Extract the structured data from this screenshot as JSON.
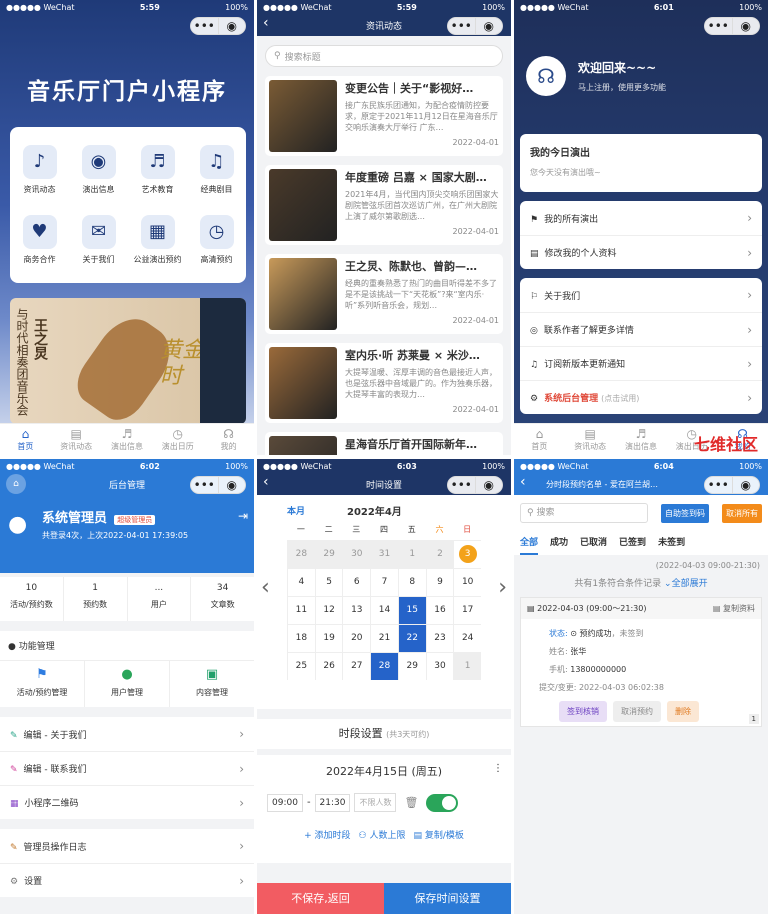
{
  "status": {
    "carrier": "●●●●● WeChat",
    "wifi": "⌔",
    "battery": "100%"
  },
  "p1": {
    "time": "5:59",
    "title": "音乐厅门户小程序",
    "grid": [
      {
        "label": "资讯动态",
        "icon": "♪"
      },
      {
        "label": "演出信息",
        "icon": "◉"
      },
      {
        "label": "艺术教育",
        "icon": "♬"
      },
      {
        "label": "经典剧目",
        "icon": "♫"
      },
      {
        "label": "商务合作",
        "icon": "♥"
      },
      {
        "label": "关于我们",
        "icon": "✉"
      },
      {
        "label": "公益演出预约",
        "icon": "▦"
      },
      {
        "label": "高清预约",
        "icon": "◷"
      }
    ],
    "poster_text": "与时代相奏团音乐会",
    "poster_name": "王之炅",
    "poster_gold": "黄金时",
    "tabs": [
      {
        "label": "首页",
        "icon": "⌂"
      },
      {
        "label": "资讯动态",
        "icon": "▤"
      },
      {
        "label": "演出信息",
        "icon": "♬"
      },
      {
        "label": "演出日历",
        "icon": "◷"
      },
      {
        "label": "我的",
        "icon": "☊"
      }
    ]
  },
  "p2": {
    "time": "5:59",
    "title": "资讯动态",
    "search_placeholder": "搜索标题",
    "news": [
      {
        "title": "变更公告｜关于“影视好…",
        "desc": "接广东民族乐团通知，为配合疫情防控要求，原定于2021年11月12日在星海音乐厅交响乐演奏大厅举行 广东…",
        "date": "2022-04-01"
      },
      {
        "title": "年度重磅 吕嘉 × 国家大剧…",
        "desc": "2021年4月，当代国内顶尖交响乐团国家大剧院管弦乐团首次巡访广州，在广州大剧院上演了威尔第歌剧选…",
        "date": "2022-04-01"
      },
      {
        "title": "王之炅、陈默也、曾韵—…",
        "desc": "经典的重奏熟悉了热门的曲目听得差不多了是不是该挑战一下“天花板”?来“室内乐·听”系列听音乐会，规划…",
        "date": "2022-04-01"
      },
      {
        "title": "室内乐·听 苏莱曼 × 米沙…",
        "desc": "大提琴温暖、浑厚丰调的音色最接近人声，也是弦乐器中音域最广的。作为独奏乐器，大提琴丰富的表现力…",
        "date": "2022-04-01"
      },
      {
        "title": "星海音乐厅首开国际新年…",
        "desc": "",
        "date": ""
      }
    ]
  },
  "p3": {
    "time": "6:01",
    "welcome": "欢迎回来~~~",
    "sub": "马上注册，使用更多功能",
    "today_title": "我的今日演出",
    "today_empty": "您今天没有演出哦~",
    "menu1": [
      {
        "icon": "⚑",
        "label": "我的所有演出"
      },
      {
        "icon": "▤",
        "label": "修改我的个人资料"
      }
    ],
    "menu2": [
      {
        "icon": "⚐",
        "label": "关于我们"
      },
      {
        "icon": "◎",
        "label": "联系作者了解更多详情"
      },
      {
        "icon": "♫",
        "label": "订阅新版本更新通知"
      },
      {
        "icon": "⚙",
        "label": "系统后台管理",
        "note": "(点击试用)"
      }
    ],
    "tabs": [
      {
        "label": "首页",
        "icon": "⌂"
      },
      {
        "label": "资讯动态",
        "icon": "▤"
      },
      {
        "label": "演出信息",
        "icon": "♬"
      },
      {
        "label": "演出日历",
        "icon": "◷"
      },
      {
        "label": "我的",
        "icon": "☊"
      }
    ],
    "watermark": "七维社区"
  },
  "p4": {
    "time": "6:02",
    "title": "后台管理",
    "name": "系统管理员",
    "badge": "超级管理员",
    "sub": "共登录4次，上次2022-04-01 17:39:05",
    "stats": [
      {
        "v": "10",
        "l": "活动/预约数"
      },
      {
        "v": "1",
        "l": "预约数"
      },
      {
        "v": "...",
        "l": "用户"
      },
      {
        "v": "34",
        "l": "文章数"
      }
    ],
    "func_title": "功能管理",
    "funcs": [
      {
        "icon": "⚑",
        "label": "活动/预约管理",
        "color": "#2f7de1"
      },
      {
        "icon": "●",
        "label": "用户管理",
        "color": "#2aa55a"
      },
      {
        "icon": "▣",
        "label": "内容管理",
        "color": "#22a06b"
      }
    ],
    "menu1": [
      {
        "icon": "✎",
        "label": "编辑 - 关于我们",
        "color": "#2aa58a"
      },
      {
        "icon": "✎",
        "label": "编辑 - 联系我们",
        "color": "#d0409a"
      },
      {
        "icon": "▦",
        "label": "小程序二维码",
        "color": "#8a4cc8"
      }
    ],
    "menu2": [
      {
        "icon": "✎",
        "label": "管理员操作日志",
        "color": "#c0762a"
      },
      {
        "icon": "⚙",
        "label": "设置",
        "color": "#777"
      }
    ]
  },
  "p5": {
    "time": "6:03",
    "title": "时间设置",
    "this_month": "本月",
    "month": "2022年4月",
    "weekdays": [
      "日",
      "一",
      "二",
      "三",
      "四",
      "五",
      "六",
      "日"
    ],
    "days": [
      [
        "28",
        "29",
        "30",
        "31",
        "1",
        "2",
        "3"
      ],
      [
        "4",
        "5",
        "6",
        "7",
        "8",
        "9",
        "10"
      ],
      [
        "11",
        "12",
        "13",
        "14",
        "15",
        "16",
        "17"
      ],
      [
        "18",
        "19",
        "20",
        "21",
        "22",
        "23",
        "24"
      ],
      [
        "25",
        "26",
        "27",
        "28",
        "29",
        "30",
        "1"
      ]
    ],
    "slot_title": "时段设置",
    "slot_note": "(共3天可约)",
    "date_label": "2022年4月15日 (周五)",
    "start": "09:00",
    "sep": "-",
    "end": "21:30",
    "limit_ph": "不限人数",
    "actions": [
      "+ 添加时段",
      "⚇ 人数上限",
      "▤ 复制/模板"
    ],
    "btn_cancel": "不保存,返回",
    "btn_save": "保存时间设置"
  },
  "p6": {
    "time": "6:04",
    "title": "分时段预约名单 - 爱在阿兰胡…",
    "search_ph": "搜索",
    "btn_export": "自助签到码",
    "btn_cancel_all": "取消所有",
    "tabs": [
      "全部",
      "成功",
      "已取消",
      "已签到",
      "未签到"
    ],
    "range": "(2022-04-03 09:00-21:30)",
    "count": "共有1条符合条件记录",
    "expand": "⌄全部展开",
    "card_time": "▤ 2022-04-03 (09:00～21:30)",
    "copy": "▤ 复制资料",
    "status_label": "状态:",
    "status_val": "⊙ 预约成功",
    "status_extra": "，未签到",
    "name_label": "姓名:",
    "name_val": "张华",
    "phone_label": "手机:",
    "phone_val": "13800000000",
    "submit_label": "提交/变更:",
    "submit_val": "2022-04-03 06:02:38",
    "btns": [
      "签到核销",
      "取消预约",
      "删除"
    ],
    "page": "1"
  }
}
